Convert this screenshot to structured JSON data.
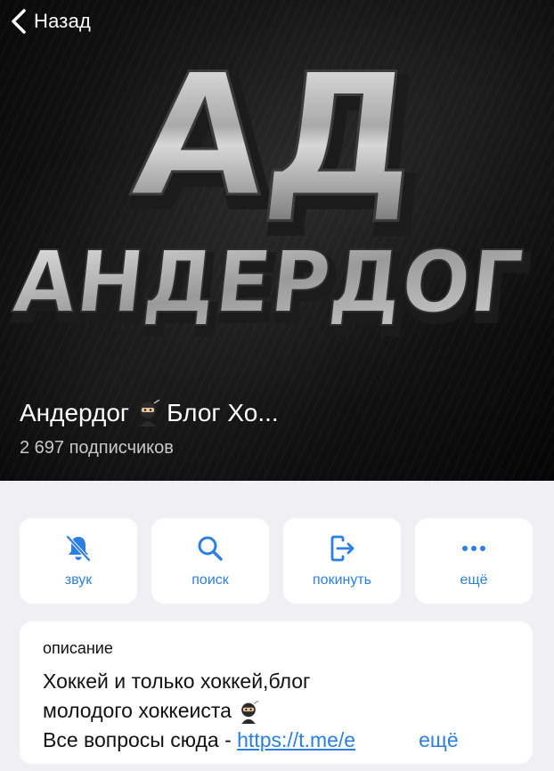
{
  "header": {
    "back_label": "Назад"
  },
  "banner": {
    "logo_line1": "АД",
    "logo_line2": "АНДЕРДОГ"
  },
  "channel": {
    "name_part1": "Андердог",
    "name_part2": "Блог Хо...",
    "subscribers": "2 697 подписчиков"
  },
  "actions": [
    {
      "label": "звук",
      "icon": "bell-slash-icon"
    },
    {
      "label": "поиск",
      "icon": "search-icon"
    },
    {
      "label": "покинуть",
      "icon": "leave-icon"
    },
    {
      "label": "ещё",
      "icon": "more-dots-icon"
    }
  ],
  "description": {
    "heading": "описание",
    "line1": "Хоккей и только хоккей,блог",
    "line2": "молодого хоккеиста",
    "line3_text": "Все вопросы сюда - ",
    "line3_link": "https://t.me/e",
    "more": "ещё"
  },
  "colors": {
    "accent": "#2b7fe0",
    "background": "#efeff4",
    "card": "#ffffff"
  }
}
